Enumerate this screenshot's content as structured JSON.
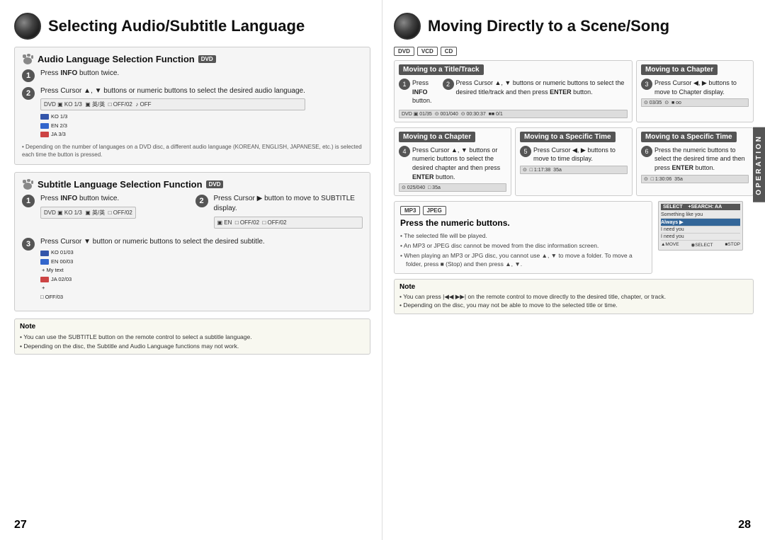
{
  "left": {
    "title": "Selecting Audio/Subtitle Language",
    "page_number": "27",
    "audio_section": {
      "title": "Audio Language Selection Function",
      "badge": "DVD",
      "step1": {
        "num": "1",
        "text": "Press INFO button twice."
      },
      "step2": {
        "num": "2",
        "text": "Press Cursor ▲, ▼ buttons or numeric buttons to select the desired audio language."
      },
      "note": "Depending on the number of languages on a DVD disc, a different audio language (KOREAN, ENGLISH, JAPANESE, etc.) is selected each time the button is pressed."
    },
    "subtitle_section": {
      "title": "Subtitle Language Selection Function",
      "badge": "DVD",
      "step1": {
        "num": "1",
        "text": "Press INFO button twice."
      },
      "step2": {
        "num": "2",
        "text": "Press Cursor ▶ button to move to SUBTITLE display."
      },
      "step3": {
        "num": "3",
        "text": "Press Cursor ▼ button or numeric buttons to select the desired subtitle."
      }
    },
    "note_box": {
      "title": "Note",
      "items": [
        "You can use the SUBTITLE button on the remote control to select a subtitle language.",
        "Depending on the disc, the Subtitle and Audio Language functions may not work."
      ]
    }
  },
  "right": {
    "title": "Moving Directly to a Scene/Song",
    "page_number": "28",
    "badges": [
      "DVD",
      "VCD",
      "CD"
    ],
    "title_track_section": {
      "header": "Moving to a Title/Track",
      "step1": {
        "num": "1",
        "text": "Press INFO button."
      },
      "step2": {
        "num": "2",
        "text": "Press Cursor ▲, ▼ buttons or numeric buttons to select the desired title/track and then press ENTER button."
      }
    },
    "chapter_section_top": {
      "header": "Moving to a Chapter",
      "step3": {
        "num": "3",
        "text": "Press Cursor ◀, ▶ buttons to move to Chapter display."
      }
    },
    "chapter_section_mid": {
      "header": "Moving to a Chapter",
      "step4": {
        "num": "4",
        "text": "Press Cursor ▲, ▼ buttons or numeric buttons to select the desired chapter and then press ENTER button."
      }
    },
    "specific_time_mid": {
      "header": "Moving to a Specific Time",
      "step5": {
        "num": "5",
        "text": "Press Cursor ◀, ▶ buttons to move to time display."
      }
    },
    "specific_time_right": {
      "header": "Moving to a Specific Time",
      "step6": {
        "num": "6",
        "text": "Press the numeric buttons to select the desired time and then press ENTER button."
      }
    },
    "mp3_section": {
      "badges": [
        "MP3",
        "JPEG"
      ],
      "step_text": "Press the numeric buttons.",
      "bullets": [
        "The selected file will be played.",
        "An MP3 or JPEG disc cannot be moved from the disc information screen.",
        "When playing an MP3 or JPG disc, you cannot use ▲, ▼ to move a folder. To move a folder, press ■ (Stop) and then press ▲, ▼."
      ]
    },
    "note_box": {
      "title": "Note",
      "items": [
        "You can press |◀◀ ▶▶| on the remote control to move directly to the desired title, chapter, or track.",
        "Depending on the disc, you may not be able to move to the selected title or time."
      ]
    },
    "operation_label": "OPERATION"
  }
}
